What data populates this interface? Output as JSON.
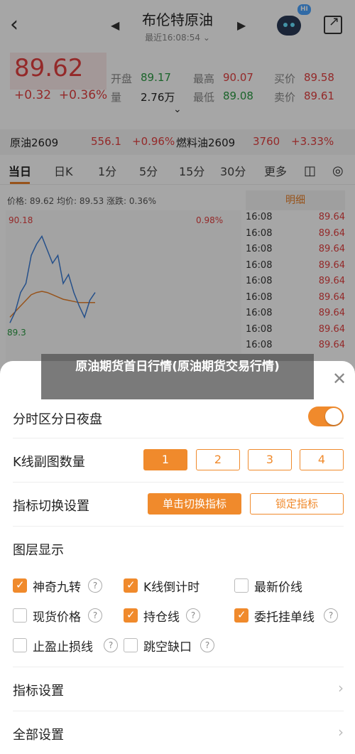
{
  "nav": {
    "title": "布伦特原油",
    "subtitle": "最近16:08:54 ⌄",
    "hi_badge": "HI"
  },
  "quote": {
    "price": "89.62",
    "change": "+0.32",
    "change_pct": "+0.36%",
    "open_label": "开盘",
    "open": "89.17",
    "high_label": "最高",
    "high": "90.07",
    "bid_label": "买价",
    "bid": "89.58",
    "vol_label": "量",
    "vol": "2.76万",
    "low_label": "最低",
    "low": "89.08",
    "ask_label": "卖价",
    "ask": "89.61"
  },
  "ticker": {
    "name1": "原油2609",
    "price1": "556.1",
    "pct1": "+0.96%",
    "name2": "燃料油2609",
    "price2": "3760",
    "pct2": "+3.33%"
  },
  "period_tabs": [
    "当日",
    "日K",
    "1分",
    "5分",
    "15分",
    "30分",
    "更多"
  ],
  "chart": {
    "info": "价格: 89.62  均价: 89.53  涨跌: 0.36%",
    "y_high": "90.18",
    "y_low": "89.3",
    "pct_label": "0.98%",
    "price_line": [
      89.35,
      89.45,
      89.62,
      89.7,
      89.95,
      90.05,
      90.12,
      90.0,
      89.88,
      89.95,
      89.7,
      89.78,
      89.62,
      89.5,
      89.4,
      89.55,
      89.62
    ],
    "avg_line": [
      89.4,
      89.45,
      89.5,
      89.55,
      89.6,
      89.62,
      89.63,
      89.62,
      89.6,
      89.58,
      89.56,
      89.55,
      89.54,
      89.53,
      89.53,
      89.53,
      89.53
    ]
  },
  "detail": {
    "header": "明细",
    "rows": [
      {
        "time": "16:08",
        "price": "89.64"
      },
      {
        "time": "16:08",
        "price": "89.64"
      },
      {
        "time": "16:08",
        "price": "89.64"
      },
      {
        "time": "16:08",
        "price": "89.64"
      },
      {
        "time": "16:08",
        "price": "89.64"
      },
      {
        "time": "16:08",
        "price": "89.64"
      },
      {
        "time": "16:08",
        "price": "89.64"
      },
      {
        "time": "16:08",
        "price": "89.64"
      },
      {
        "time": "16:08",
        "price": "89.64"
      }
    ]
  },
  "headline": "原油期货首日行情(原油期货交易行情)",
  "sheet": {
    "night_label": "分时区分日夜盘",
    "kline_count_label": "K线副图数量",
    "kline_options": [
      "1",
      "2",
      "3",
      "4"
    ],
    "switch_label": "指标切换设置",
    "switch_btn": "单击切换指标",
    "lock_btn": "锁定指标",
    "layers_label": "图层显示",
    "layers": [
      {
        "label": "神奇九转",
        "checked": true,
        "help": "?"
      },
      {
        "label": "K线倒计时",
        "checked": true,
        "help": ""
      },
      {
        "label": "最新价线",
        "checked": false,
        "help": ""
      },
      {
        "label": "现货价格",
        "checked": false,
        "help": "?"
      },
      {
        "label": "持仓线",
        "checked": true,
        "help": "?"
      },
      {
        "label": "委托挂单线",
        "checked": true,
        "help": "?"
      },
      {
        "label": "止盈止损线",
        "checked": false,
        "help": "?"
      },
      {
        "label": "跳空缺口",
        "checked": false,
        "help": "?"
      }
    ],
    "indicator_settings": "指标设置",
    "all_settings": "全部设置"
  }
}
